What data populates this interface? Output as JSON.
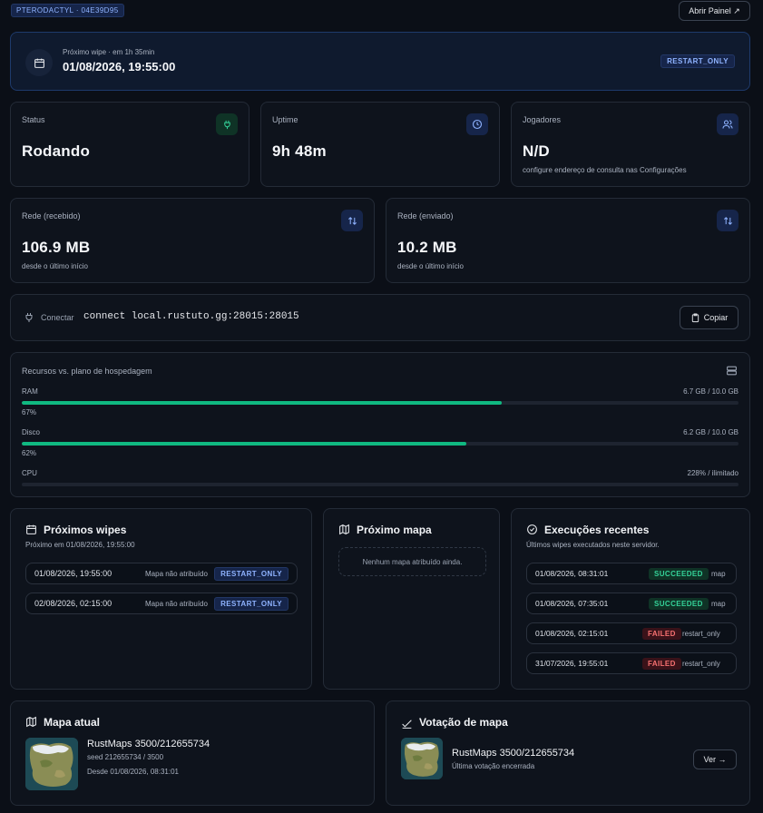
{
  "top": {
    "server_tag": "PTERODACTYL · 04E39D95",
    "open_panel_label": "Abrir Painel ↗"
  },
  "wipe_banner": {
    "label": "Próximo wipe · em 1h 35min",
    "datetime": "01/08/2026, 19:55:00",
    "badge": "RESTART_ONLY"
  },
  "stats": {
    "status": {
      "label": "Status",
      "value": "Rodando"
    },
    "uptime": {
      "label": "Uptime",
      "value": "9h 48m"
    },
    "players": {
      "label": "Jogadores",
      "value": "N/D",
      "hint": "configure endereço de consulta nas Configurações"
    },
    "net_in": {
      "label": "Rede (recebido)",
      "value": "106.9 MB",
      "hint": "desde o último início"
    },
    "net_out": {
      "label": "Rede (enviado)",
      "value": "10.2 MB",
      "hint": "desde o último início"
    }
  },
  "connect": {
    "label": "Conectar",
    "command": "connect local.rustuto.gg:28015:28015",
    "copy_label": "Copiar"
  },
  "resources": {
    "title": "Recursos vs. plano de hospedagem",
    "ram": {
      "label": "RAM",
      "usage": "6.7 GB / 10.0 GB",
      "percent_label": "67%",
      "percent": 67
    },
    "disk": {
      "label": "Disco",
      "usage": "6.2 GB / 10.0 GB",
      "percent_label": "62%",
      "percent": 62
    },
    "cpu": {
      "label": "CPU",
      "usage": "228% / ilimitado",
      "percent": 0
    }
  },
  "next_wipes": {
    "title": "Próximos wipes",
    "subtitle": "Próximo em 01/08/2026, 19:55:00",
    "rows": [
      {
        "date": "01/08/2026, 19:55:00",
        "map": "Mapa não atribuído",
        "badge": "RESTART_ONLY"
      },
      {
        "date": "02/08/2026, 02:15:00",
        "map": "Mapa não atribuído",
        "badge": "RESTART_ONLY"
      }
    ]
  },
  "next_map": {
    "title": "Próximo mapa",
    "empty": "Nenhum mapa atribuído ainda."
  },
  "recent_runs": {
    "title": "Execuções recentes",
    "subtitle": "Últimos wipes executados neste servidor.",
    "rows": [
      {
        "date": "01/08/2026, 08:31:01",
        "status": "SUCCEEDED",
        "kind": "map"
      },
      {
        "date": "01/08/2026, 07:35:01",
        "status": "SUCCEEDED",
        "kind": "map"
      },
      {
        "date": "01/08/2026, 02:15:01",
        "status": "FAILED",
        "kind": "restart_only"
      },
      {
        "date": "31/07/2026, 19:55:01",
        "status": "FAILED",
        "kind": "restart_only"
      }
    ]
  },
  "current_map": {
    "title": "Mapa atual",
    "name": "RustMaps 3500/212655734",
    "seed": "seed 212655734 / 3500",
    "since": "Desde 01/08/2026, 08:31:01"
  },
  "map_vote": {
    "title": "Votação de mapa",
    "name": "RustMaps 3500/212655734",
    "status": "Última votação encerrada",
    "view_label": "Ver →"
  },
  "colors": {
    "accent_green": "#10b981",
    "accent_blue": "#8fb3ff",
    "failed_red": "#f87171"
  }
}
